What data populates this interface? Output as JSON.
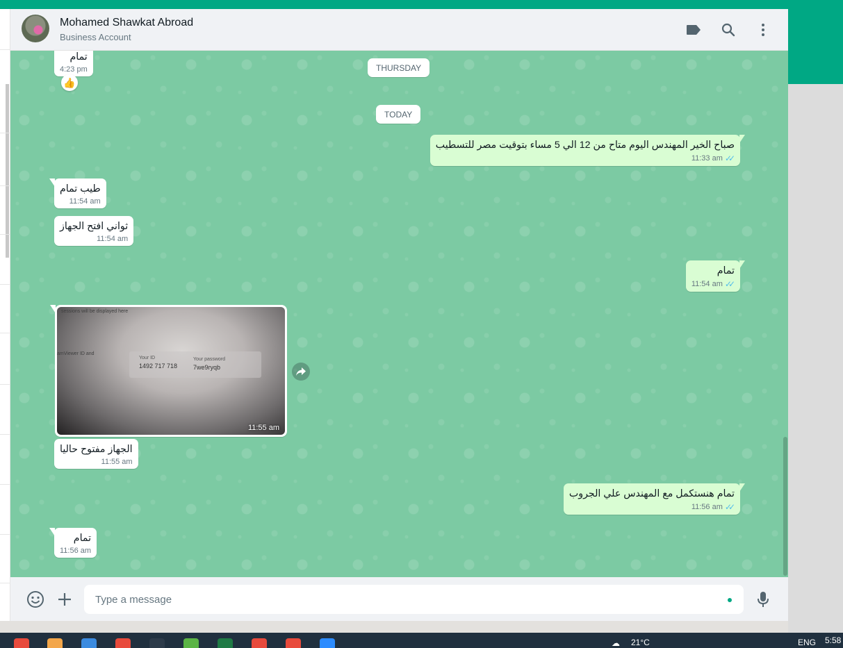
{
  "colors": {
    "brand": "#00a884",
    "chat_bg": "#7ccaa3",
    "outgoing": "#d9fdd3",
    "incoming": "#ffffff",
    "read_ticks": "#53bdeb"
  },
  "header": {
    "name": "Mohamed Shawkat Abroad",
    "subtitle": "Business Account",
    "icons": [
      "label-icon",
      "search-icon",
      "menu-icon"
    ]
  },
  "chat": {
    "dates": {
      "thursday": "THURSDAY",
      "today": "TODAY"
    },
    "messages": [
      {
        "dir": "in",
        "text": "تمام",
        "time": "4:23 pm",
        "reaction": "👍"
      },
      {
        "dir": "out",
        "text": "صباح الخير المهندس اليوم متاح من  12 الي 5 مساء بتوقيت مصر للتسطيب",
        "time": "11:33 am"
      },
      {
        "dir": "in",
        "text": "طيب تمام",
        "time": "11:54 am"
      },
      {
        "dir": "in",
        "text": "ثواني افتح الجهاز",
        "time": "11:54 am"
      },
      {
        "dir": "out",
        "text": "تمام",
        "time": "11:54 am"
      },
      {
        "dir": "in",
        "type": "image",
        "time": "11:55 am",
        "image_text": {
          "top": "sessions will be displayed here",
          "left": "amViewer ID and",
          "id_label": "Your ID",
          "id_value": "1492 717 718",
          "pw_label": "Your password",
          "pw_value": "7we9ryqb"
        }
      },
      {
        "dir": "in",
        "text": "الجهاز مفتوح حاليا",
        "time": "11:55 am"
      },
      {
        "dir": "out",
        "text": "تمام هنستكمل مع المهندس علي الجروب",
        "time": "11:56 am"
      },
      {
        "dir": "in",
        "text": "تمام",
        "time": "11:56 am"
      }
    ]
  },
  "composer": {
    "placeholder": "Type a message",
    "value": ""
  },
  "taskbar": {
    "apps": [
      "chrome",
      "paint",
      "photos",
      "chrome",
      "inkscape",
      "sheets",
      "excel",
      "chrome",
      "chrome",
      "zoom"
    ],
    "weather": "21°C",
    "lang": "ENG",
    "clock": "5:58"
  }
}
